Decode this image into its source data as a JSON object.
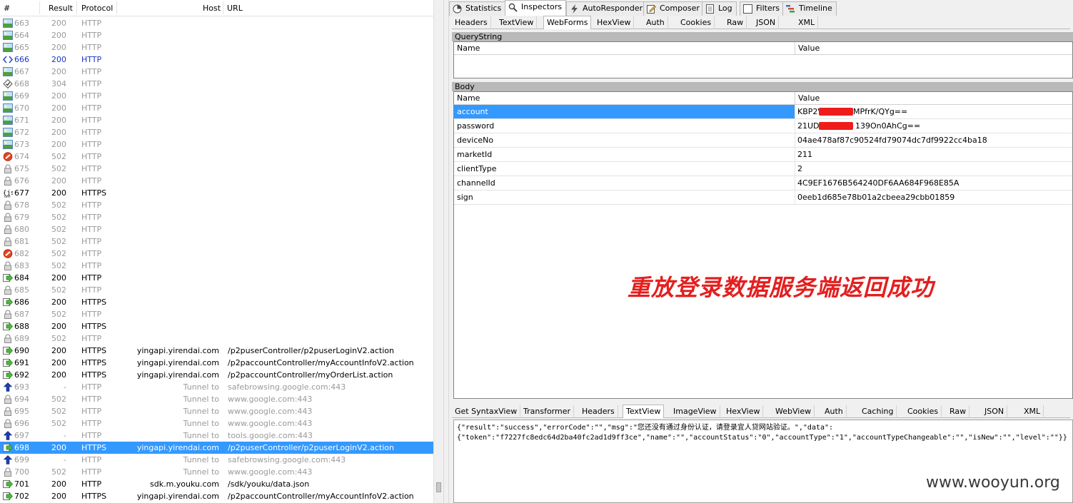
{
  "list": {
    "headers": {
      "num": "#",
      "result": "Result",
      "protocol": "Protocol",
      "host": "Host",
      "url": "URL"
    },
    "rows": [
      {
        "num": "663",
        "result": "200",
        "protocol": "HTTP",
        "host": "",
        "url": "",
        "icon": "image-icon",
        "style": "gray"
      },
      {
        "num": "664",
        "result": "200",
        "protocol": "HTTP",
        "host": "",
        "url": "",
        "icon": "image-icon",
        "style": "gray"
      },
      {
        "num": "665",
        "result": "200",
        "protocol": "HTTP",
        "host": "",
        "url": "",
        "icon": "image-icon",
        "style": "gray"
      },
      {
        "num": "666",
        "result": "200",
        "protocol": "HTTP",
        "host": "",
        "url": "",
        "icon": "script-icon",
        "style": "blue"
      },
      {
        "num": "667",
        "result": "200",
        "protocol": "HTTP",
        "host": "",
        "url": "",
        "icon": "image-icon",
        "style": "gray"
      },
      {
        "num": "668",
        "result": "304",
        "protocol": "HTTP",
        "host": "",
        "url": "",
        "icon": "cache-icon",
        "style": "gray"
      },
      {
        "num": "669",
        "result": "200",
        "protocol": "HTTP",
        "host": "",
        "url": "",
        "icon": "image-icon",
        "style": "gray"
      },
      {
        "num": "670",
        "result": "200",
        "protocol": "HTTP",
        "host": "",
        "url": "",
        "icon": "image-icon",
        "style": "gray"
      },
      {
        "num": "671",
        "result": "200",
        "protocol": "HTTP",
        "host": "",
        "url": "",
        "icon": "image-icon",
        "style": "gray"
      },
      {
        "num": "672",
        "result": "200",
        "protocol": "HTTP",
        "host": "",
        "url": "",
        "icon": "image-icon",
        "style": "gray"
      },
      {
        "num": "673",
        "result": "200",
        "protocol": "HTTP",
        "host": "",
        "url": "",
        "icon": "image-icon",
        "style": "gray"
      },
      {
        "num": "674",
        "result": "502",
        "protocol": "HTTP",
        "host": "",
        "url": "",
        "icon": "blocked-icon",
        "style": "gray"
      },
      {
        "num": "675",
        "result": "502",
        "protocol": "HTTP",
        "host": "",
        "url": "",
        "icon": "lock-icon",
        "style": "gray"
      },
      {
        "num": "676",
        "result": "200",
        "protocol": "HTTP",
        "host": "",
        "url": "",
        "icon": "lock-icon",
        "style": "gray"
      },
      {
        "num": "677",
        "result": "200",
        "protocol": "HTTPS",
        "host": "",
        "url": "",
        "icon": "json-icon",
        "style": "dark"
      },
      {
        "num": "678",
        "result": "502",
        "protocol": "HTTP",
        "host": "",
        "url": "",
        "icon": "lock-icon",
        "style": "gray"
      },
      {
        "num": "679",
        "result": "502",
        "protocol": "HTTP",
        "host": "",
        "url": "",
        "icon": "lock-icon",
        "style": "gray"
      },
      {
        "num": "680",
        "result": "502",
        "protocol": "HTTP",
        "host": "",
        "url": "",
        "icon": "lock-icon",
        "style": "gray"
      },
      {
        "num": "681",
        "result": "502",
        "protocol": "HTTP",
        "host": "",
        "url": "",
        "icon": "lock-icon",
        "style": "gray"
      },
      {
        "num": "682",
        "result": "502",
        "protocol": "HTTP",
        "host": "",
        "url": "",
        "icon": "blocked-icon",
        "style": "gray"
      },
      {
        "num": "683",
        "result": "502",
        "protocol": "HTTP",
        "host": "",
        "url": "",
        "icon": "lock-icon",
        "style": "gray"
      },
      {
        "num": "684",
        "result": "200",
        "protocol": "HTTP",
        "host": "",
        "url": "",
        "icon": "post-icon",
        "style": "dark"
      },
      {
        "num": "685",
        "result": "502",
        "protocol": "HTTP",
        "host": "",
        "url": "",
        "icon": "lock-icon",
        "style": "gray"
      },
      {
        "num": "686",
        "result": "200",
        "protocol": "HTTPS",
        "host": "",
        "url": "",
        "icon": "post-icon",
        "style": "dark"
      },
      {
        "num": "687",
        "result": "502",
        "protocol": "HTTP",
        "host": "",
        "url": "",
        "icon": "lock-icon",
        "style": "gray"
      },
      {
        "num": "688",
        "result": "200",
        "protocol": "HTTPS",
        "host": "",
        "url": "",
        "icon": "post-icon",
        "style": "dark"
      },
      {
        "num": "689",
        "result": "502",
        "protocol": "HTTP",
        "host": "",
        "url": "",
        "icon": "lock-icon",
        "style": "gray"
      },
      {
        "num": "690",
        "result": "200",
        "protocol": "HTTPS",
        "host": "yingapi.yirendai.com",
        "url": "/p2puserController/p2puserLoginV2.action",
        "icon": "post-icon",
        "style": "dark"
      },
      {
        "num": "691",
        "result": "200",
        "protocol": "HTTPS",
        "host": "yingapi.yirendai.com",
        "url": "/p2paccountController/myAccountInfoV2.action",
        "icon": "post-icon",
        "style": "dark"
      },
      {
        "num": "692",
        "result": "200",
        "protocol": "HTTPS",
        "host": "yingapi.yirendai.com",
        "url": "/p2paccountController/myOrderList.action",
        "icon": "post-icon",
        "style": "dark"
      },
      {
        "num": "693",
        "result": "-",
        "protocol": "HTTP",
        "host": "Tunnel to",
        "url": "safebrowsing.google.com:443",
        "icon": "upload-icon",
        "style": "gray"
      },
      {
        "num": "694",
        "result": "502",
        "protocol": "HTTP",
        "host": "Tunnel to",
        "url": "www.google.com:443",
        "icon": "lock-icon",
        "style": "gray"
      },
      {
        "num": "695",
        "result": "502",
        "protocol": "HTTP",
        "host": "Tunnel to",
        "url": "www.google.com:443",
        "icon": "lock-icon",
        "style": "gray"
      },
      {
        "num": "696",
        "result": "502",
        "protocol": "HTTP",
        "host": "Tunnel to",
        "url": "www.google.com:443",
        "icon": "lock-icon",
        "style": "gray"
      },
      {
        "num": "697",
        "result": "-",
        "protocol": "HTTP",
        "host": "Tunnel to",
        "url": "tools.google.com:443",
        "icon": "upload-icon",
        "style": "gray"
      },
      {
        "num": "698",
        "result": "200",
        "protocol": "HTTPS",
        "host": "yingapi.yirendai.com",
        "url": "/p2puserController/p2puserLoginV2.action",
        "icon": "post-icon",
        "style": "sel"
      },
      {
        "num": "699",
        "result": "-",
        "protocol": "HTTP",
        "host": "Tunnel to",
        "url": "safebrowsing.google.com:443",
        "icon": "upload-icon",
        "style": "gray"
      },
      {
        "num": "700",
        "result": "502",
        "protocol": "HTTP",
        "host": "Tunnel to",
        "url": "www.google.com:443",
        "icon": "lock-icon",
        "style": "gray"
      },
      {
        "num": "701",
        "result": "200",
        "protocol": "HTTP",
        "host": "sdk.m.youku.com",
        "url": "/sdk/youku/data.json",
        "icon": "post-icon",
        "style": "dark"
      },
      {
        "num": "702",
        "result": "200",
        "protocol": "HTTPS",
        "host": "yingapi.yirendai.com",
        "url": "/p2paccountController/myAccountInfoV2.action",
        "icon": "post-icon",
        "style": "dark"
      }
    ]
  },
  "tabs": {
    "top": [
      {
        "label": "Statistics",
        "icon": "statistics-icon"
      },
      {
        "label": "Inspectors",
        "icon": "inspectors-icon",
        "active": true
      },
      {
        "label": "AutoResponder",
        "icon": "lightning-icon"
      },
      {
        "label": "Composer",
        "icon": "composer-icon"
      },
      {
        "label": "Log",
        "icon": "log-icon"
      },
      {
        "label": "Filters",
        "icon": "filters-icon"
      },
      {
        "label": "Timeline",
        "icon": "timeline-icon"
      }
    ],
    "request": [
      "Headers",
      "TextView",
      "WebForms",
      "HexView",
      "Auth",
      "Cookies",
      "Raw",
      "JSON",
      "XML"
    ],
    "request_active": "WebForms",
    "response": [
      "Get SyntaxView",
      "Transformer",
      "Headers",
      "TextView",
      "ImageView",
      "HexView",
      "WebView",
      "Auth",
      "Caching",
      "Cookies",
      "Raw",
      "JSON",
      "XML"
    ],
    "response_active": "TextView"
  },
  "querystring": {
    "title": "QueryString",
    "col_name": "Name",
    "col_value": "Value"
  },
  "body": {
    "title": "Body",
    "col_name": "Name",
    "col_value": "Value",
    "rows": [
      {
        "name": "account",
        "value_start": "KBP2V",
        "value_end": "MPfrK/QYg==",
        "redacted": true
      },
      {
        "name": "password",
        "value_start": "21UDv",
        "value_end": "139On0AhCg==",
        "redacted": true
      },
      {
        "name": "deviceNo",
        "value": "04ae478af87c90524fd79074dc7df9922cc4ba18"
      },
      {
        "name": "marketId",
        "value": "211"
      },
      {
        "name": "clientType",
        "value": "2"
      },
      {
        "name": "channelId",
        "value": "4C9EF1676B564240DF6AA684F968E85A"
      },
      {
        "name": "sign",
        "value": "0eeb1d685e78b01a2cbeea29cbb01859"
      }
    ]
  },
  "annotation": "重放登录数据服务端返回成功",
  "response": {
    "line1": "{\"result\":\"success\",\"errorCode\":\"\",\"msg\":\"您还没有通过身份认证，请登录宜人贷网站验证。\",\"data\":",
    "line2": "{\"token\":\"f7227fc8edc64d2ba40fc2ad1d9ff3ce\",\"name\":\"\",\"accountStatus\":\"0\",\"accountType\":\"1\",\"accountTypeChangeable\":\"\",\"isNew\":\"\",\"level\":\"\"}}"
  },
  "watermark": "www.wooyun.org",
  "colors": {
    "selection": "#3399ff",
    "annotation": "#e31f1f",
    "redaction": "#ef1c1c"
  }
}
